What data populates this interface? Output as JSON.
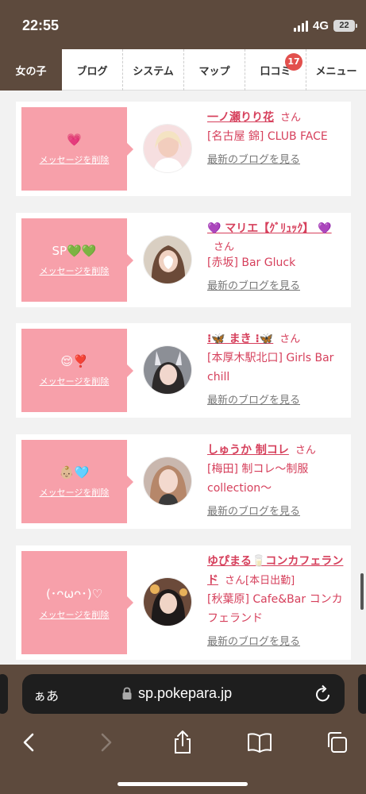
{
  "status_bar": {
    "time": "22:55",
    "network": "4G",
    "battery": "22"
  },
  "nav": {
    "tabs": [
      {
        "label": "女の子",
        "active": true
      },
      {
        "label": "ブログ"
      },
      {
        "label": "システム"
      },
      {
        "label": "マップ"
      },
      {
        "label": "口コミ",
        "badge": "17"
      },
      {
        "label": "メニュー"
      }
    ]
  },
  "cards": [
    {
      "message": "💗",
      "delete_label": "メッセージを削除",
      "name": "一ノ瀬りり花",
      "honorific": "さん",
      "shop": "[名古屋 錦] CLUB FACE",
      "blog_label": "最新のブログを見る"
    },
    {
      "message": "SP💚💚",
      "delete_label": "メッセージを削除",
      "name": "💜 マリエ【ｸﾞﾘｭｯｸ】 💜",
      "honorific": "さん",
      "shop": "[赤坂] Bar Gluck",
      "blog_label": "最新のブログを見る"
    },
    {
      "message": "😌❣️",
      "delete_label": "メッセージを削除",
      "name": "⁝🦋 まき ⁝🦋",
      "honorific": "さん",
      "shop": "[本厚木駅北口] Girls Bar chill",
      "blog_label": "最新のブログを見る"
    },
    {
      "message": "👶🏼🩵",
      "delete_label": "メッセージを削除",
      "name": "しゅうか 制コレ",
      "honorific": "さん",
      "shop": "[梅田] 制コレ～制服collection～",
      "blog_label": "最新のブログを見る"
    },
    {
      "message": "(･ᴖωᴖ･)♡",
      "delete_label": "メッセージを削除",
      "name": "ゆぴまる🥛コンカフェランド",
      "honorific": "さん[本日出勤]",
      "shop": "[秋葉原] Cafe&Bar コンカフェランド",
      "blog_label": "最新のブログを見る"
    }
  ],
  "safari": {
    "aa_label": "ぁあ",
    "url": "sp.pokepara.jp"
  },
  "icons": [
    "signal-icon",
    "battery-icon",
    "lock-icon",
    "reload-icon",
    "back-icon",
    "forward-icon",
    "share-icon",
    "bookmarks-icon",
    "tabs-icon"
  ]
}
